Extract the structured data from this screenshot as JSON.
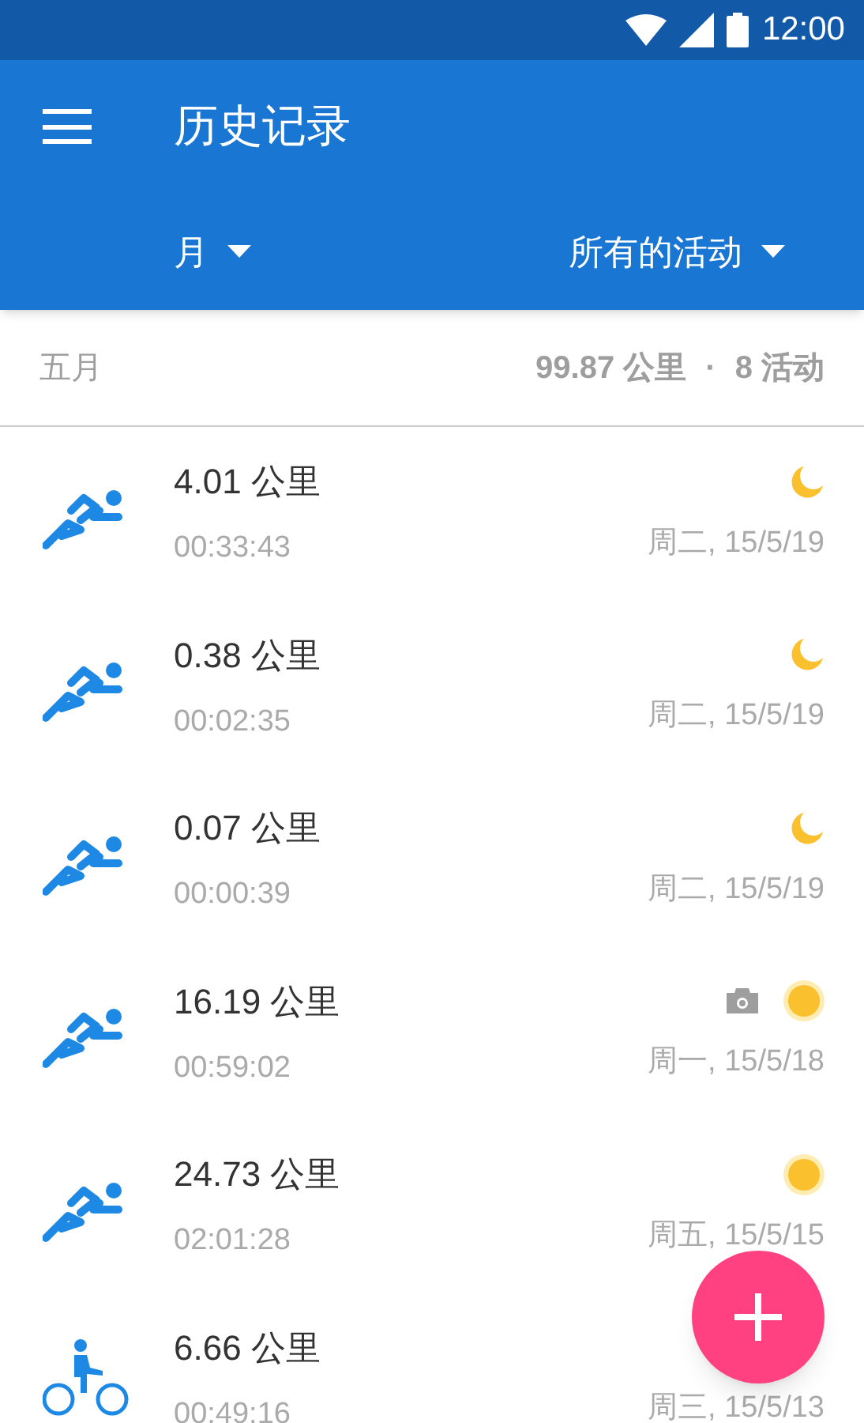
{
  "status_bar": {
    "time": "12:00"
  },
  "app_bar": {
    "title": "历史记录"
  },
  "filters": [
    {
      "label": "月"
    },
    {
      "label": "所有的活动"
    }
  ],
  "summary": {
    "period": "五月",
    "distance": "99.87 公里",
    "separator": "·",
    "count": "8 活动"
  },
  "activities": [
    {
      "kind": "run",
      "distance": "4.01 公里",
      "duration": "00:33:43",
      "date": "周二, 15/5/19",
      "night": true,
      "photo": false
    },
    {
      "kind": "run",
      "distance": "0.38 公里",
      "duration": "00:02:35",
      "date": "周二, 15/5/19",
      "night": true,
      "photo": false
    },
    {
      "kind": "run",
      "distance": "0.07 公里",
      "duration": "00:00:39",
      "date": "周二, 15/5/19",
      "night": true,
      "photo": false
    },
    {
      "kind": "run",
      "distance": "16.19 公里",
      "duration": "00:59:02",
      "date": "周一, 15/5/18",
      "night": false,
      "photo": true
    },
    {
      "kind": "run",
      "distance": "24.73 公里",
      "duration": "02:01:28",
      "date": "周五, 15/5/15",
      "night": false,
      "photo": false
    },
    {
      "kind": "bike",
      "distance": "6.66 公里",
      "duration": "00:49:16",
      "date": "周三, 15/5/13",
      "photo": false
    }
  ]
}
